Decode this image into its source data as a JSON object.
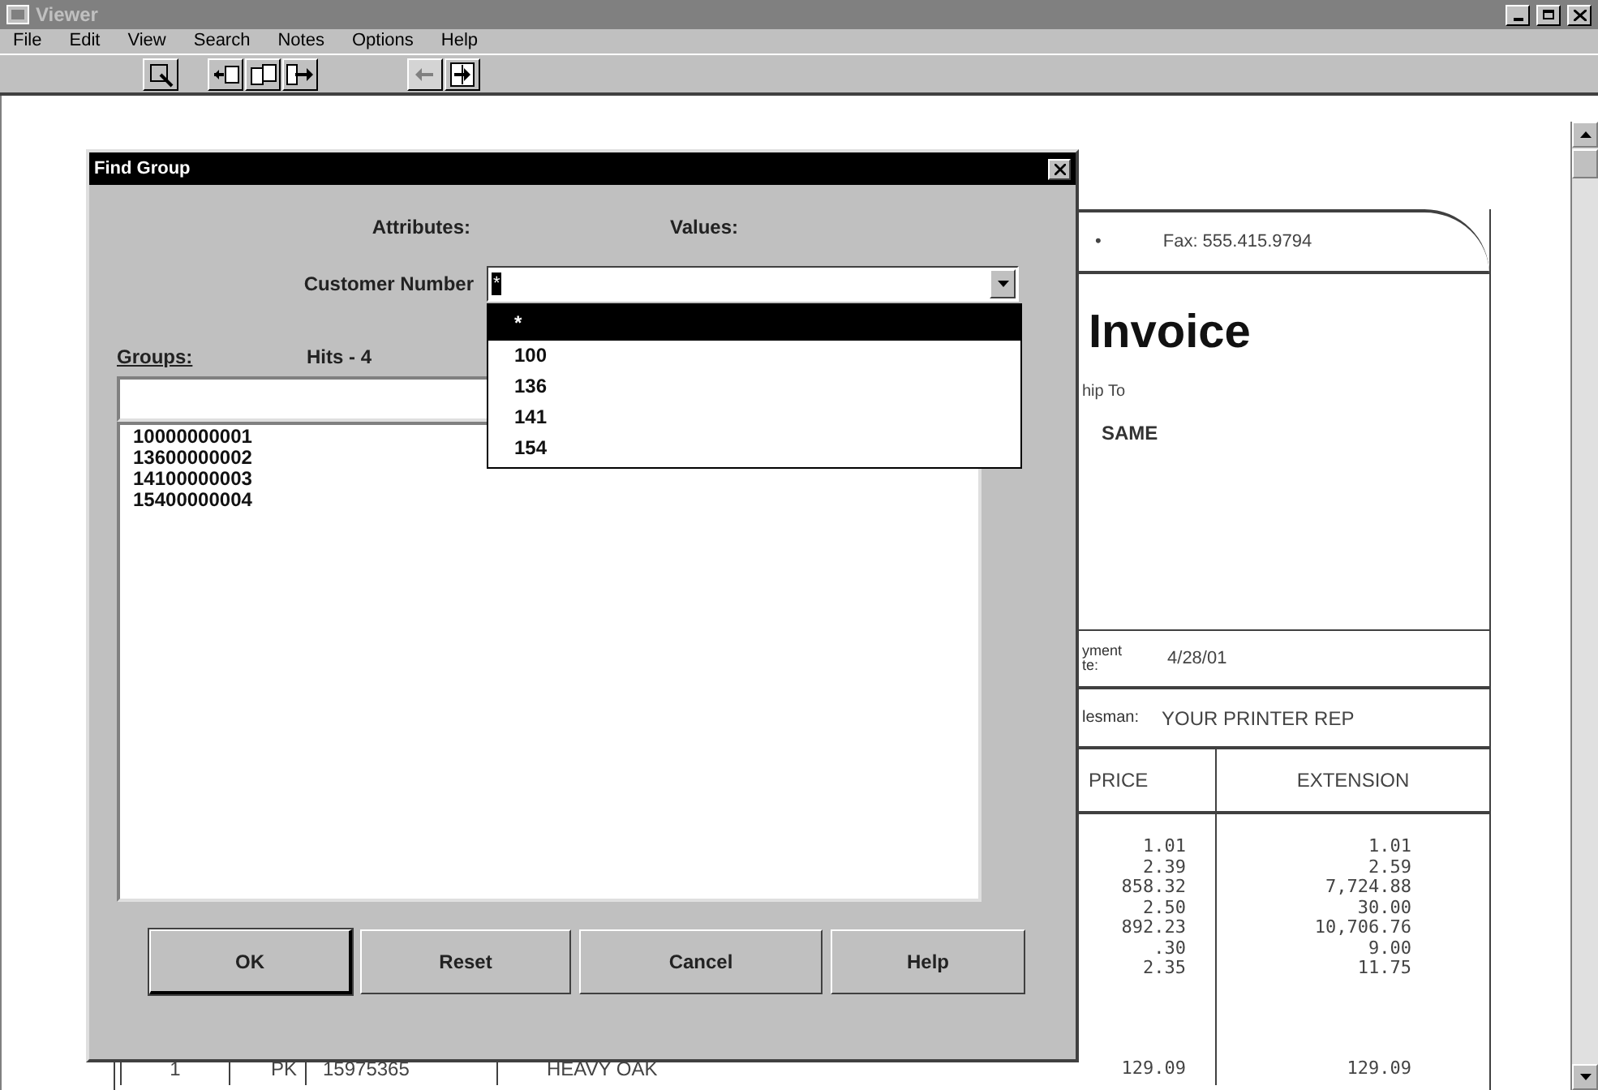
{
  "window": {
    "title": "Viewer"
  },
  "menu": [
    {
      "label": "File"
    },
    {
      "label": "Edit"
    },
    {
      "label": "View"
    },
    {
      "label": "Search"
    },
    {
      "label": "Notes"
    },
    {
      "label": "Options"
    },
    {
      "label": "Help"
    }
  ],
  "toolbar": [
    {
      "kind": "zoom",
      "disabled": false
    },
    {
      "kind": "first",
      "disabled": false
    },
    {
      "kind": "pages",
      "disabled": false
    },
    {
      "kind": "next",
      "disabled": false
    },
    {
      "kind": "back",
      "disabled": true
    },
    {
      "kind": "jump",
      "disabled": false
    }
  ],
  "invoice": {
    "bullet": "•",
    "fax": "Fax: 555.415.9794",
    "title": "Invoice",
    "ship_to_label": "hip To",
    "ship_to": "SAME",
    "date_label": [
      "yment",
      "te:"
    ],
    "date": "4/28/01",
    "salesman_label": "lesman:",
    "salesman": "YOUR PRINTER REP",
    "columns": [
      "PRICE",
      "EXTENSION"
    ],
    "rows": [
      {
        "price": "1.01",
        "extension": "1.01"
      },
      {
        "price": "2.39",
        "extension": "2.59"
      },
      {
        "price": "858.32",
        "extension": "7,724.88"
      },
      {
        "price": "2.50",
        "extension": "30.00"
      },
      {
        "price": "892.23",
        "extension": "10,706.76"
      },
      {
        "price": ".30",
        "extension": "9.00"
      },
      {
        "price": "2.35",
        "extension": "11.75"
      }
    ],
    "last_row": {
      "qty": "1",
      "unit": "PK",
      "item": "15975365",
      "description": "HEAVY OAK",
      "price": "129.09",
      "extension": "129.09"
    }
  },
  "dialog": {
    "title": "Find Group",
    "attributes_header": "Attributes:",
    "values_header": "Values:",
    "attribute": "Customer Number",
    "combo_value": "*",
    "dropdown": [
      {
        "label": "*",
        "selected": true
      },
      {
        "label": "100",
        "selected": false
      },
      {
        "label": "136",
        "selected": false
      },
      {
        "label": "141",
        "selected": false
      },
      {
        "label": "154",
        "selected": false
      }
    ],
    "groups_label": "Groups:",
    "hits": "Hits - 4",
    "groups": [
      {
        "label": "10000000001"
      },
      {
        "label": "13600000002"
      },
      {
        "label": "14100000003"
      },
      {
        "label": "15400000004"
      }
    ],
    "buttons": [
      {
        "label": "OK",
        "default": true
      },
      {
        "label": "Reset",
        "default": false
      },
      {
        "label": "Cancel",
        "default": false
      },
      {
        "label": "Help",
        "default": false
      }
    ]
  }
}
